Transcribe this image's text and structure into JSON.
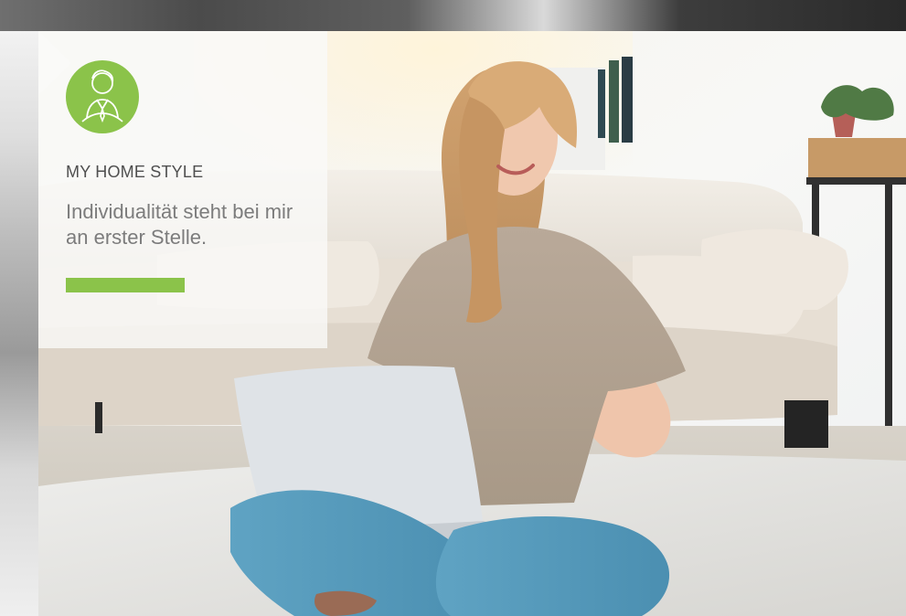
{
  "colors": {
    "accent": "#8bc34a",
    "title_text": "#4f4f4f",
    "body_text": "#7c7c7c"
  },
  "card": {
    "icon": "person-avatar-icon",
    "eyebrow": "MY HOME STYLE",
    "tagline": "Individualität steht bei mir an erster Stelle."
  },
  "hero": {
    "subject": "woman-with-laptop-photo"
  }
}
